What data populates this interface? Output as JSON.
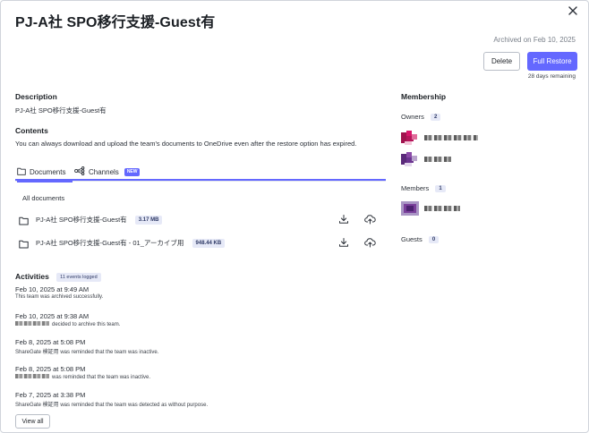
{
  "header": {
    "title": "PJ-A社 SPO移行支援-Guest有",
    "archived_on": "Archived on Feb 10, 2025",
    "delete_label": "Delete",
    "restore_label": "Full Restore",
    "days_remaining": "28 days remaining"
  },
  "description": {
    "heading": "Description",
    "text": "PJ-A社 SPO移行支援-Guest有"
  },
  "contents": {
    "heading": "Contents",
    "text": "You can always download and upload the team's documents to OneDrive even after the restore option has expired.",
    "tabs": [
      {
        "label": "Documents",
        "icon": "folder-icon",
        "active": true
      },
      {
        "label": "Channels",
        "icon": "channels-icon",
        "badge": "NEW",
        "active": false
      }
    ],
    "all_documents_label": "All documents",
    "documents": [
      {
        "name": "PJ-A社 SPO移行支援-Guest有",
        "size": "3.17 MB"
      },
      {
        "name": "PJ-A社 SPO移行支援-Guest有 - 01_アーカイブ用",
        "size": "948.44 KB"
      }
    ]
  },
  "activities": {
    "heading": "Activities",
    "count_badge": "11 events logged",
    "items": [
      {
        "date": "Feb 10, 2025 at 9:49 AM",
        "text": "This team was archived successfully."
      },
      {
        "date": "Feb 10, 2025 at 9:38 AM",
        "text": "decided to archive this team."
      },
      {
        "date": "Feb 8, 2025 at 5:08 PM",
        "text": "ShareGate 検証用 was reminded that the team was inactive."
      },
      {
        "date": "Feb 8, 2025 at 5:08 PM",
        "text": "was reminded that the team was inactive."
      },
      {
        "date": "Feb 7, 2025 at 3:38 PM",
        "text": "ShareGate 検証用 was reminded that the team was detected as without purpose."
      }
    ],
    "view_all_label": "View all"
  },
  "membership": {
    "heading": "Membership",
    "owners_label": "Owners",
    "owners_count": "2",
    "members_label": "Members",
    "members_count": "1",
    "guests_label": "Guests",
    "guests_count": "0"
  },
  "colors": {
    "accent": "#6468ff",
    "badge_bg": "#e6e9f7"
  }
}
